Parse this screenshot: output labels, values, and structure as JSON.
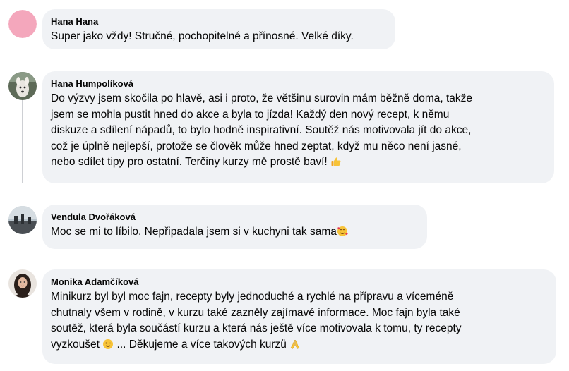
{
  "comments": [
    {
      "author": "Hana Hana",
      "lines": [
        "Super jako vždy! Stručné, pochopitelné a přínosné. Velké díky."
      ]
    },
    {
      "author": "Hana Humpolíková",
      "lines": [
        "Do výzvy jsem skočila po hlavě, asi i proto, že většinu surovin mám běžně doma, takže",
        "jsem se mohla pustit hned do akce a byla to jízda! Každý den nový recept, k němu",
        "diskuze a sdílení nápadů, to bylo hodně inspirativní. Soutěž nás motivovala jít do akce,",
        "což je úplně nejlepší, protože se člověk může hned zeptat, když mu něco není jasné,",
        "nebo sdílet tipy pro ostatní. Terčiny kurzy mě prostě baví!"
      ],
      "trailing_emoji": "thumbs-up-emoji"
    },
    {
      "author": "Vendula Dvořáková",
      "lines": [
        "Moc se mi to líbilo. Nepřipadala jsem si v kuchyni tak sama"
      ],
      "trailing_emoji": "smiling-face-with-hearts-emoji"
    },
    {
      "author": "Monika Adamčíková",
      "lines": [
        "Minikurz byl byl moc fajn, recepty byly jednoduché a rychlé na přípravu a víceméně",
        "chutnaly všem v rodině, v kurzu také zazněly zajímavé informace. Moc fajn byla také",
        "soutěž, která byla součástí kurzu a která nás ještě více motivovala k tomu, ty recepty"
      ],
      "last_line_before": "vyzkoušet",
      "last_line_middle": "... Děkujeme a více takových kurzů",
      "emojis": [
        "winking-face-emoji",
        "folded-hands-emoji"
      ]
    }
  ],
  "colors": {
    "bubble": "#f0f2f5",
    "text": "#050505",
    "avatar_pink": "#f4a7bc",
    "thread_line": "#ced0d4",
    "emoji_yellow": "#f7c338"
  }
}
